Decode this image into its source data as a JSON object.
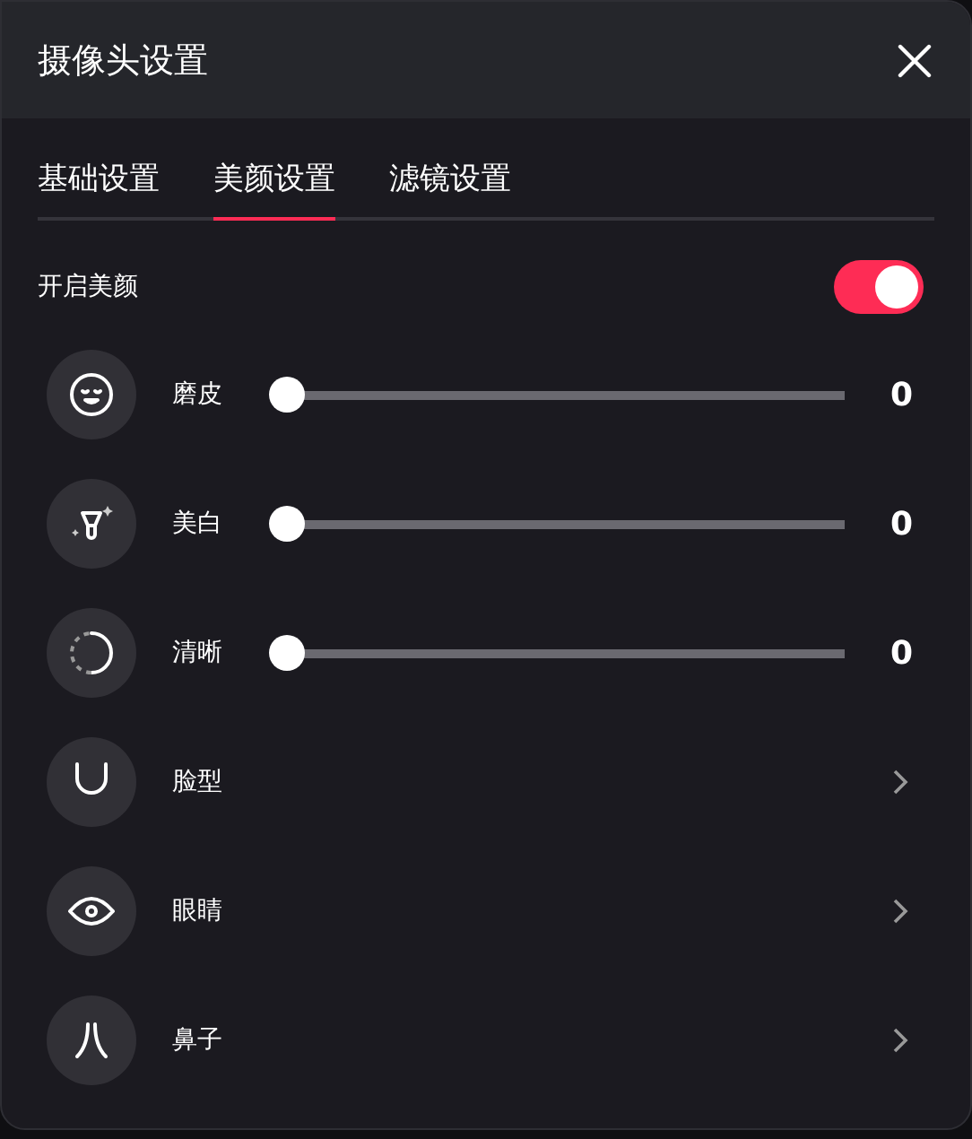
{
  "window": {
    "title": "摄像头设置"
  },
  "tabs": [
    {
      "label": "基础设置",
      "selected": false
    },
    {
      "label": "美颜设置",
      "selected": true
    },
    {
      "label": "滤镜设置",
      "selected": false
    }
  ],
  "beauty_toggle": {
    "label": "开启美颜",
    "on": true
  },
  "items": [
    {
      "kind": "slider",
      "label": "磨皮",
      "level": 0,
      "reading": "0"
    },
    {
      "kind": "slider",
      "label": "美白",
      "level": 0,
      "reading": "0"
    },
    {
      "kind": "slider",
      "label": "清晰",
      "level": 0,
      "reading": "0"
    },
    {
      "kind": "link",
      "label": "脸型"
    },
    {
      "kind": "link",
      "label": "眼睛"
    },
    {
      "kind": "link",
      "label": "鼻子"
    }
  ]
}
